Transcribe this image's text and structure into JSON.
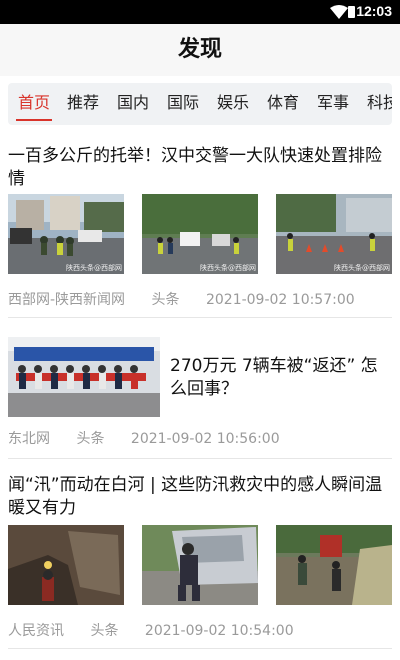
{
  "status_bar": {
    "time": "12:03"
  },
  "header": {
    "title": "发现"
  },
  "tabs": [
    "首页",
    "推荐",
    "国内",
    "国际",
    "娱乐",
    "体育",
    "军事",
    "科技"
  ],
  "active_tab": "首页",
  "articles": [
    {
      "title": "一百多公斤的托举！汉中交警一大队快速处置排险情",
      "source": "西部网-陕西新闻网",
      "tag": "头条",
      "time": "2021-09-02 10:57:00",
      "watermark": "陕西头条@西部网"
    },
    {
      "title": "270万元 7辆车被“返还” 怎么回事？",
      "source": "东北网",
      "tag": "头条",
      "time": "2021-09-02 10:56:00"
    },
    {
      "title": "闻“汛”而动在白河 | 这些防汛救灾中的感人瞬间温暖又有力",
      "source": "人民资讯",
      "tag": "头条",
      "time": "2021-09-02 10:54:00"
    }
  ],
  "colors": {
    "accent": "#d9342b",
    "meta": "#9a9a9a",
    "tab_bg": "#f0f2f4"
  }
}
